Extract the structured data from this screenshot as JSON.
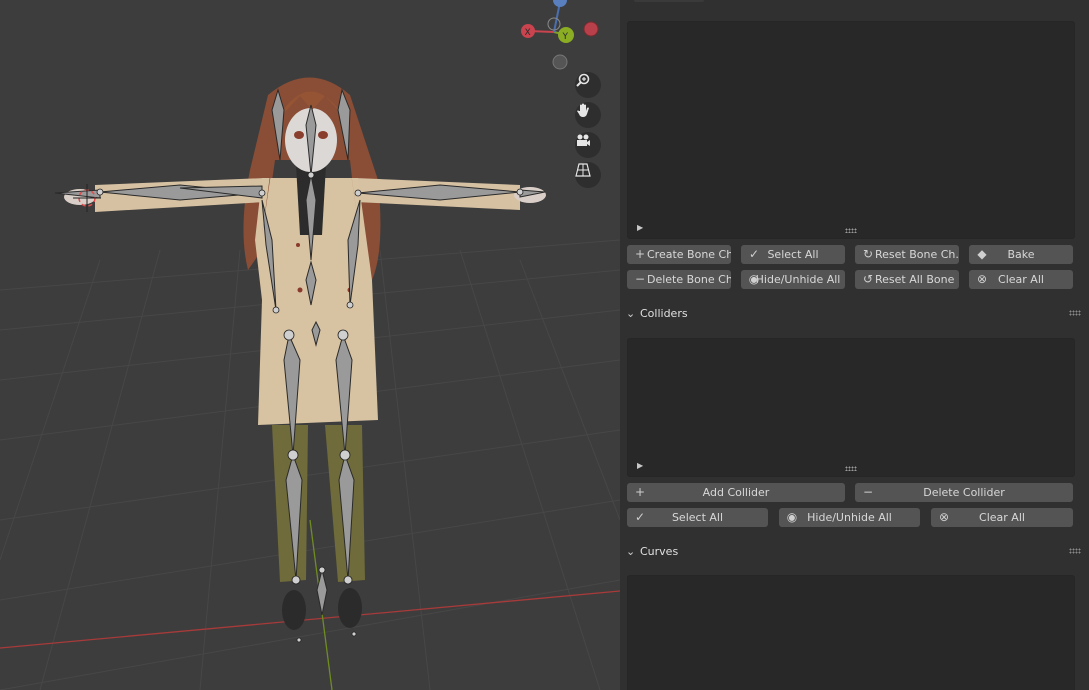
{
  "viewport": {
    "gizmo": {
      "x_label": "X",
      "y_label": "Y"
    },
    "nav_icons": [
      "zoom-icon",
      "hand-pan-icon",
      "camera-icon",
      "grid-perspective-icon"
    ]
  },
  "bone_chain_buttons": {
    "create": "Create Bone Ch...",
    "select_all": "Select All",
    "reset": "Reset Bone Ch...",
    "bake": "Bake",
    "delete": "Delete Bone Ch...",
    "hide_unhide": "Hide/Unhide All",
    "reset_all": "Reset All Bone ...",
    "clear_all": "Clear All"
  },
  "colliders": {
    "title": "Colliders",
    "add": "Add Collider",
    "delete": "Delete Collider",
    "select_all": "Select All",
    "hide_unhide": "Hide/Unhide All",
    "clear_all": "Clear All"
  },
  "curves": {
    "title": "Curves"
  },
  "colors": {
    "panel_bg": "#303030",
    "list_bg": "#282828",
    "button_bg": "#545454",
    "viewport_bg": "#3d3d3d",
    "axis_x": "#c9444e",
    "axis_y": "#7f9f25"
  }
}
